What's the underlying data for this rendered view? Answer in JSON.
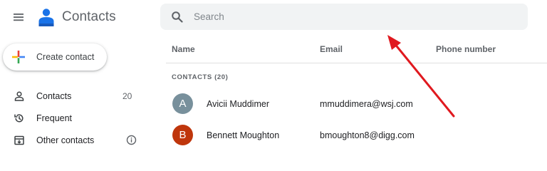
{
  "app": {
    "title": "Contacts",
    "menu_icon": "hamburger-menu-icon",
    "logo_icon": "contacts-person-logo-icon",
    "logo_color": "#1a73e8"
  },
  "search": {
    "placeholder": "Search",
    "value": "",
    "icon": "search-icon"
  },
  "create_button": {
    "label": "Create contact",
    "icon": "multicolor-plus-icon",
    "colors": [
      "#4285f4",
      "#ea4335",
      "#fbbc04",
      "#34a853"
    ]
  },
  "sidebar": {
    "items": [
      {
        "label": "Contacts",
        "count": "20",
        "icon": "person-outline-icon"
      },
      {
        "label": "Frequent",
        "icon": "history-icon"
      },
      {
        "label": "Other contacts",
        "icon": "archive-box-icon",
        "trailing_icon": "info-icon"
      }
    ]
  },
  "table": {
    "columns": [
      "Name",
      "Email",
      "Phone number"
    ],
    "section_label": "CONTACTS (20)",
    "rows": [
      {
        "initial": "A",
        "name": "Avicii Muddimer",
        "email": "mmuddimera@wsj.com",
        "phone": "",
        "avatar_color": "#78909c"
      },
      {
        "initial": "B",
        "name": "Bennett Moughton",
        "email": "bmoughton8@digg.com",
        "phone": "",
        "avatar_color": "#bf360c"
      }
    ]
  },
  "annotation": {
    "type": "arrow",
    "color": "#e0191f",
    "points_to": "search-bar"
  }
}
